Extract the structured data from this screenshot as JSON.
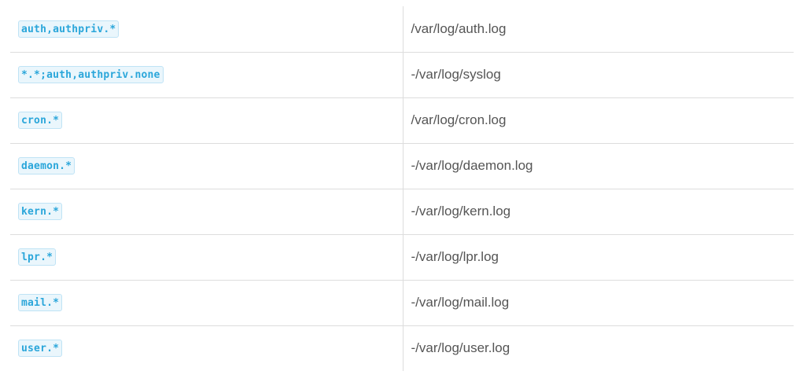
{
  "rows": [
    {
      "selector": "auth,authpriv.*",
      "path": "/var/log/auth.log"
    },
    {
      "selector": "*.*;auth,authpriv.none",
      "path": "-/var/log/syslog"
    },
    {
      "selector": "cron.*",
      "path": "/var/log/cron.log"
    },
    {
      "selector": "daemon.*",
      "path": "-/var/log/daemon.log"
    },
    {
      "selector": "kern.*",
      "path": "-/var/log/kern.log"
    },
    {
      "selector": "lpr.*",
      "path": "-/var/log/lpr.log"
    },
    {
      "selector": "mail.*",
      "path": "-/var/log/mail.log"
    },
    {
      "selector": "user.*",
      "path": "-/var/log/user.log"
    }
  ]
}
